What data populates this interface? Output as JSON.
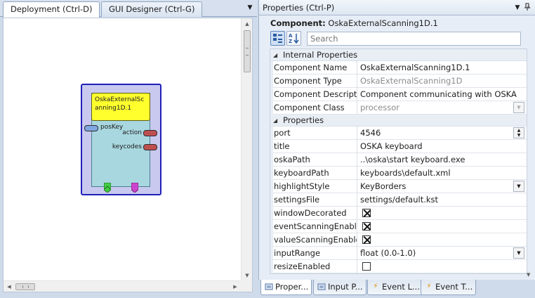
{
  "left_panel": {
    "tabs": [
      {
        "label": "Deployment (Ctrl-D)",
        "active": true
      },
      {
        "label": "GUI Designer (Ctrl-G)",
        "active": false
      }
    ],
    "component": {
      "title": "OskaExternalScanning1D.1",
      "input_ports": [
        {
          "label": "posKey"
        }
      ],
      "output_ports": [
        {
          "label": "action"
        },
        {
          "label": "keycodes"
        }
      ]
    }
  },
  "properties_panel": {
    "title": "Properties (Ctrl-P)",
    "component_label": "Component:",
    "component_name": "OskaExternalScanning1D.1",
    "search_placeholder": "Search",
    "categories": [
      {
        "name": "Internal Properties",
        "rows": [
          {
            "name": "Component Name",
            "value": "OskaExternalScanning1D.1",
            "type": "text"
          },
          {
            "name": "Component Type",
            "value": "OskaExternalScanning1D",
            "type": "readonly"
          },
          {
            "name": "Component Description",
            "value": "Component communicating with OSKA",
            "type": "text"
          },
          {
            "name": "Component Class",
            "value": "processor",
            "type": "dropdown-disabled"
          }
        ]
      },
      {
        "name": "Properties",
        "rows": [
          {
            "name": "port",
            "value": "4546",
            "type": "spinner"
          },
          {
            "name": "title",
            "value": "OSKA keyboard",
            "type": "text"
          },
          {
            "name": "oskaPath",
            "value": "..\\oska\\start keyboard.exe",
            "type": "text"
          },
          {
            "name": "keyboardPath",
            "value": "keyboards\\default.xml",
            "type": "text"
          },
          {
            "name": "highlightStyle",
            "value": "KeyBorders",
            "type": "dropdown"
          },
          {
            "name": "settingsFile",
            "value": "settings/default.kst",
            "type": "text"
          },
          {
            "name": "windowDecorated",
            "value": "",
            "checked": true,
            "type": "checkbox"
          },
          {
            "name": "eventScanningEnabled",
            "value": "",
            "checked": true,
            "type": "checkbox"
          },
          {
            "name": "valueScanningEnabled",
            "value": "",
            "checked": true,
            "type": "checkbox"
          },
          {
            "name": "inputRange",
            "value": "float (0.0-1.0)",
            "type": "dropdown"
          },
          {
            "name": "resizeEnabled",
            "value": "",
            "checked": false,
            "type": "checkbox"
          }
        ]
      }
    ]
  },
  "bottom_tabs": [
    {
      "label": "Proper...",
      "icon": "properties-icon",
      "active": true
    },
    {
      "label": "Input P...",
      "icon": "input-properties-icon",
      "active": false
    },
    {
      "label": "Event L...",
      "icon": "lightning-icon",
      "active": false
    },
    {
      "label": "Event T...",
      "icon": "lightning-icon",
      "active": false
    }
  ],
  "colors": {
    "component_frame": "#2020b8",
    "component_title_bg": "#ffff2e",
    "component_body_bg": "#a8d7df",
    "input_port": "#7fa6e0",
    "output_port": "#c05050",
    "event_in": "#44cc44",
    "event_out": "#cc44cc"
  }
}
